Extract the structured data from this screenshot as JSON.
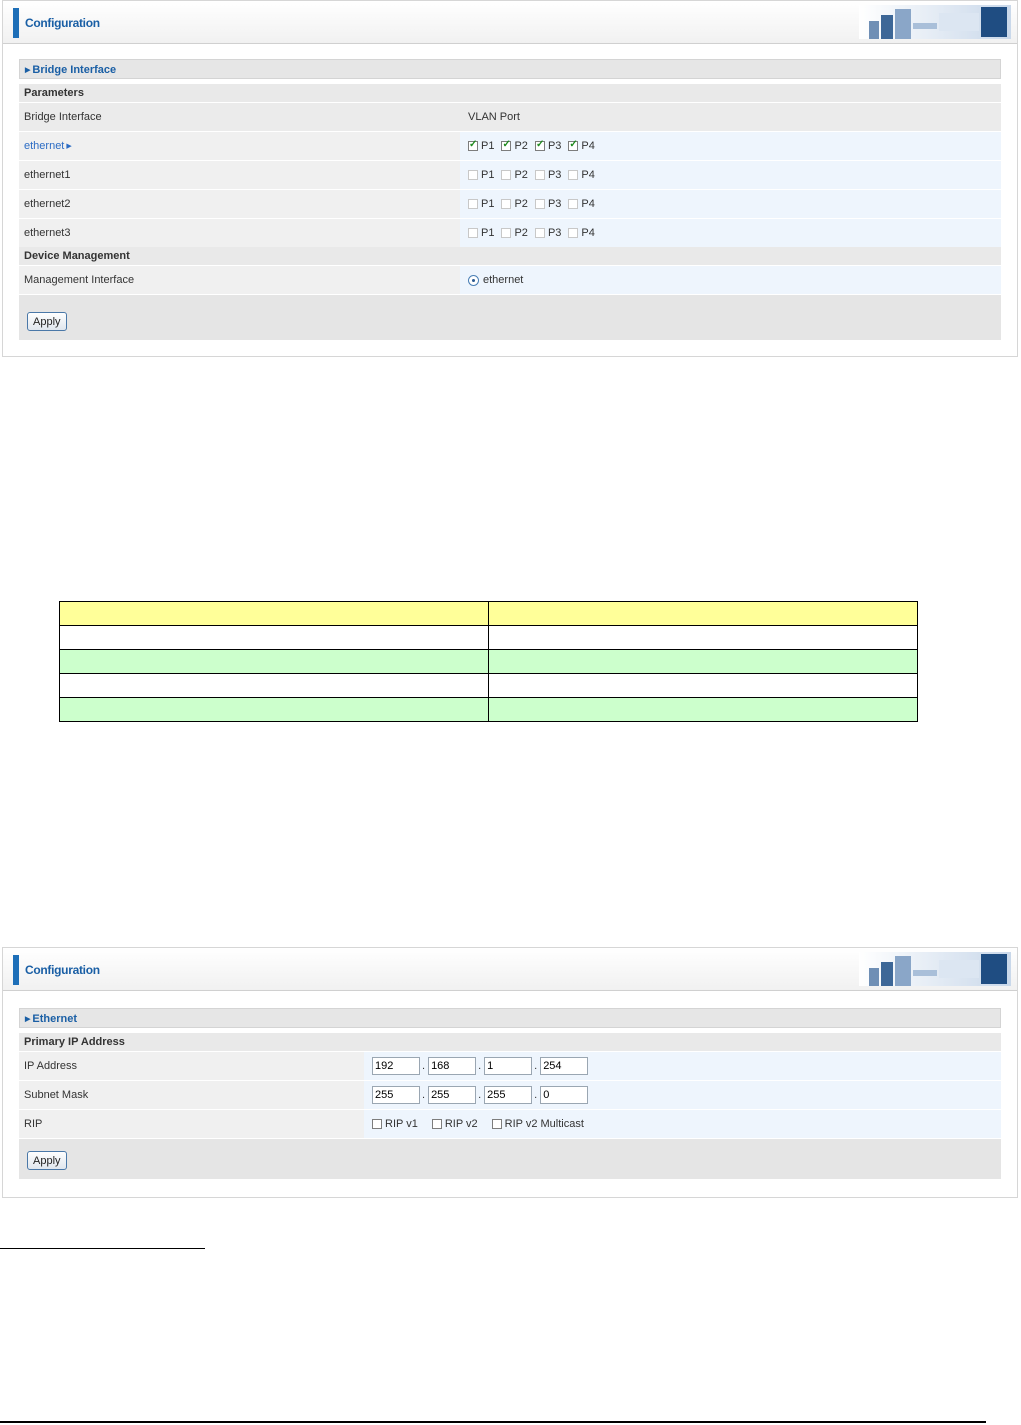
{
  "bridge_panel": {
    "header_title": "Configuration",
    "section_title": "Bridge Interface",
    "parameters_label": "Parameters",
    "col_bridge_interface": "Bridge Interface",
    "col_vlan_port": "VLAN Port",
    "rows": [
      {
        "name": "ethernet",
        "ports": {
          "P1": true,
          "P2": true,
          "P3": true,
          "P4": true
        }
      },
      {
        "name": "ethernet1",
        "ports": {
          "P1": false,
          "P2": false,
          "P3": false,
          "P4": false
        }
      },
      {
        "name": "ethernet2",
        "ports": {
          "P1": false,
          "P2": false,
          "P3": false,
          "P4": false
        }
      },
      {
        "name": "ethernet3",
        "ports": {
          "P1": false,
          "P2": false,
          "P3": false,
          "P4": false
        }
      }
    ],
    "port_labels": [
      "P1",
      "P2",
      "P3",
      "P4"
    ],
    "device_management_label": "Device Management",
    "management_interface_label": "Management Interface",
    "management_interface_value": "ethernet",
    "apply_label": "Apply"
  },
  "parameter_table": {
    "header_color": "#ffff99",
    "alt_color": "#ccffcc",
    "rows": 5,
    "columns": 2
  },
  "ethernet_panel": {
    "header_title": "Configuration",
    "section_title": "Ethernet",
    "primary_ip_label": "Primary IP Address",
    "ip_address_label": "IP Address",
    "ip_address": [
      "192",
      "168",
      "1",
      "254"
    ],
    "subnet_mask_label": "Subnet Mask",
    "subnet_mask": [
      "255",
      "255",
      "255",
      "0"
    ],
    "rip_label": "RIP",
    "rip_options": [
      {
        "label": "RIP v1",
        "checked": false
      },
      {
        "label": "RIP v2",
        "checked": false
      },
      {
        "label": "RIP v2 Multicast",
        "checked": false
      }
    ],
    "apply_label": "Apply"
  },
  "colors": {
    "brand_blue": "#1e6fb8",
    "row_blue": "#eef5fd"
  }
}
